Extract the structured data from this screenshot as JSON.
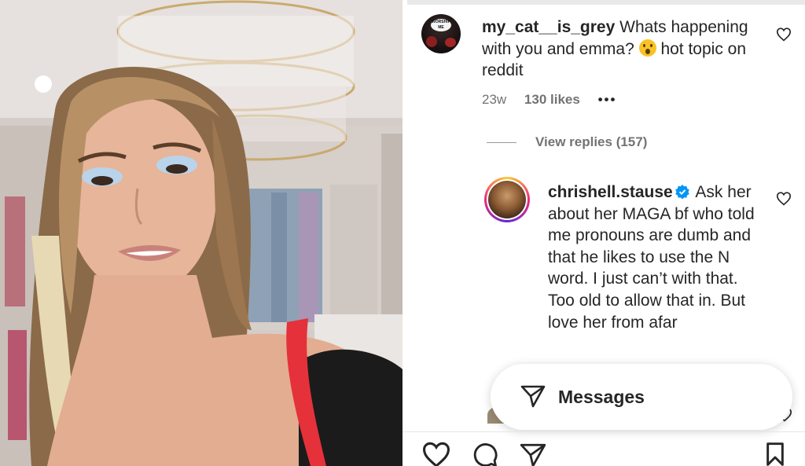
{
  "comments": [
    {
      "username": "my_cat__is_grey",
      "text_before_emoji": " Whats happening with you and emma? ",
      "emoji": "astonished-face",
      "text_after_emoji": " hot topic on reddit",
      "avatar_caption": "WORSHIP ME",
      "age": "23w",
      "likes": "130 likes",
      "more": "•••"
    },
    {
      "username": "chrishell.stause",
      "verified": true,
      "text": " Ask her about her MAGA bf who told me pronouns are dumb and that he likes to use the N word. I just can’t with that. Too old to allow that in. But love her from afar"
    }
  ],
  "view_replies": "View replies (157)",
  "messages_label": "Messages",
  "colors": {
    "text": "#262626",
    "muted": "#737373",
    "verified": "#0095f6"
  }
}
